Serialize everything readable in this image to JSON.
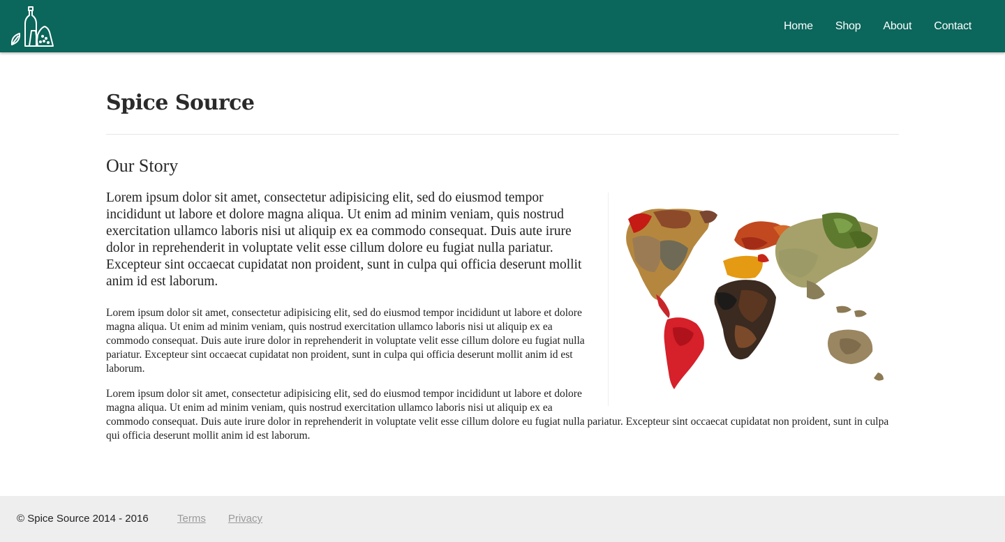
{
  "header": {
    "logo_icon": "spice-bottles-logo-icon",
    "nav": [
      {
        "label": "Home"
      },
      {
        "label": "Shop"
      },
      {
        "label": "About"
      },
      {
        "label": "Contact"
      }
    ]
  },
  "main": {
    "site_title": "Spice Source",
    "section_title": "Our Story",
    "lead": "Lorem ipsum dolor sit amet, consectetur adipisicing elit, sed do eiusmod tempor incididunt ut labore et dolore magna aliqua. Ut enim ad minim veniam, quis nostrud exercitation ullamco laboris nisi ut aliquip ex ea commodo consequat. Duis aute irure dolor in reprehenderit in voluptate velit esse cillum dolore eu fugiat nulla pariatur. Excepteur sint occaecat cupidatat non proident, sunt in culpa qui officia deserunt mollit anim id est laborum.",
    "paragraphs": [
      "Lorem ipsum dolor sit amet, consectetur adipisicing elit, sed do eiusmod tempor incididunt ut labore et dolore magna aliqua. Ut enim ad minim veniam, quis nostrud exercitation ullamco laboris nisi ut aliquip ex ea commodo consequat. Duis aute irure dolor in reprehenderit in voluptate velit esse cillum dolore eu fugiat nulla pariatur. Excepteur sint occaecat cupidatat non proident, sunt in culpa qui officia deserunt mollit anim id est laborum.",
      "Lorem ipsum dolor sit amet, consectetur adipisicing elit, sed do eiusmod tempor incididunt ut labore et dolore magna aliqua. Ut enim ad minim veniam, quis nostrud exercitation ullamco laboris nisi ut aliquip ex ea commodo consequat. Duis aute irure dolor in reprehenderit in voluptate velit esse cillum dolore eu fugiat nulla pariatur. Excepteur sint occaecat cupidatat non proident, sunt in culpa qui officia deserunt mollit anim id est laborum."
    ],
    "image_subject": "world-map-made-of-spices"
  },
  "footer": {
    "copyright": "© Spice Source 2014 - 2016",
    "links": [
      {
        "label": "Terms"
      },
      {
        "label": "Privacy"
      }
    ]
  },
  "colors": {
    "header_bg": "#0b665b",
    "footer_bg": "#eeeeee",
    "footer_link": "#9a9a9a"
  }
}
